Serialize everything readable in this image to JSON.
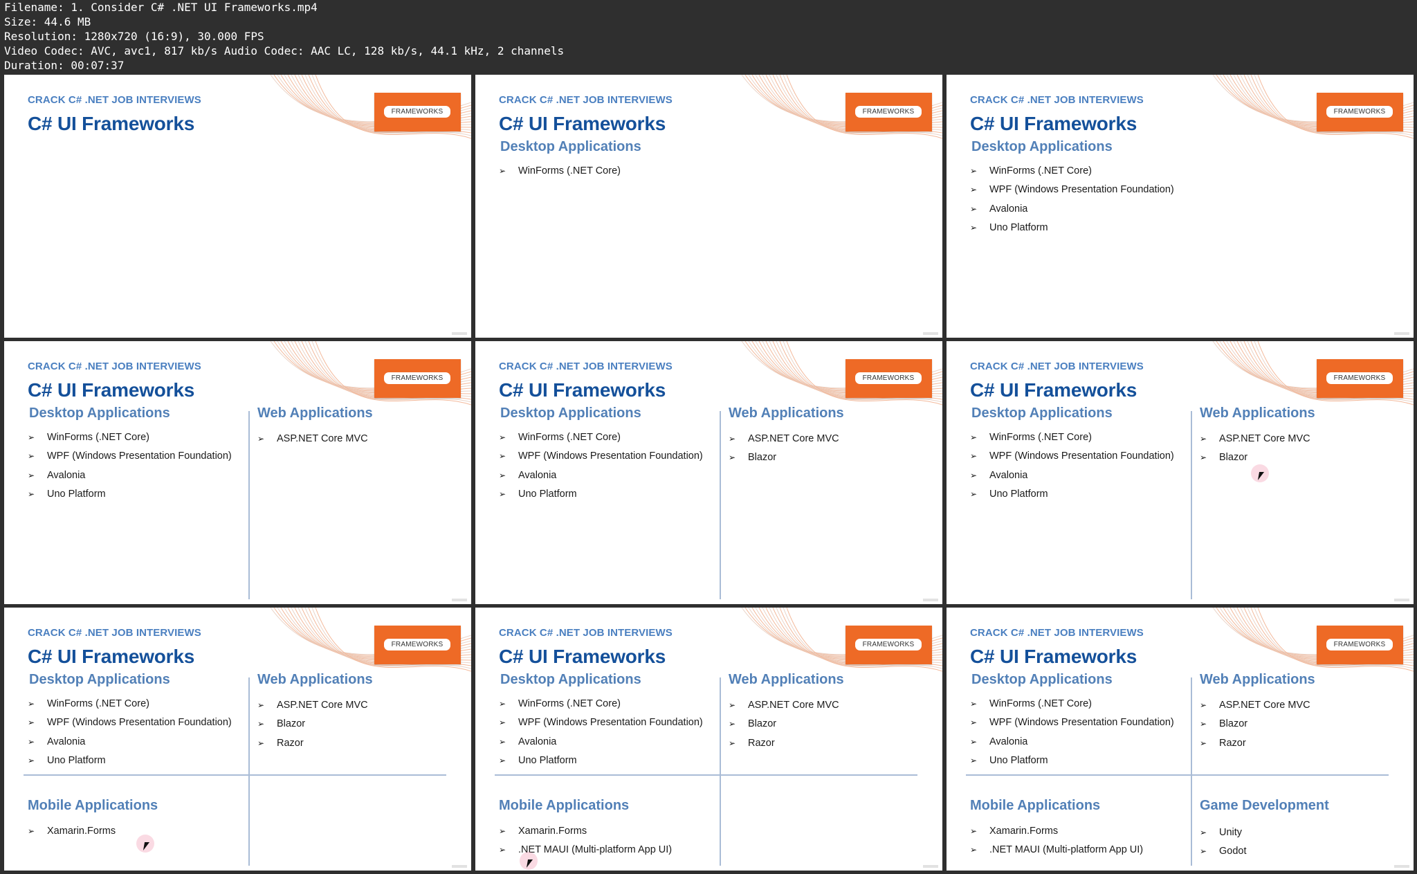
{
  "file_info": {
    "filename": "Filename: 1. Consider C# .NET UI Frameworks.mp4",
    "size": "Size: 44.6 MB",
    "resolution": "Resolution: 1280x720 (16:9), 30.000 FPS",
    "codec": "Video Codec: AVC, avc1, 817 kb/s Audio Codec: AAC LC, 128 kb/s, 44.1 kHz, 2 channels",
    "duration": "Duration: 00:07:37"
  },
  "slide": {
    "kicker": "CRACK C# .NET JOB INTERVIEWS",
    "title": "C# UI Frameworks",
    "badge": "FRAMEWORKS",
    "arrow": "➢"
  },
  "sections": {
    "desktop": "Desktop Applications",
    "web": "Web Applications",
    "mobile": "Mobile Applications",
    "game": "Game Development"
  },
  "items": {
    "desktop": [
      "WinForms (.NET Core)",
      "WPF (Windows Presentation Foundation)",
      "Avalonia",
      "Uno Platform"
    ],
    "web": [
      "ASP.NET Core MVC",
      "Blazor",
      "Razor"
    ],
    "mobile": [
      "Xamarin.Forms",
      ".NET MAUI (Multi-platform App UI)"
    ],
    "game": [
      "Unity",
      "Godot"
    ]
  },
  "thumbnails": [
    {
      "desktop": 0,
      "web": -1,
      "mobile": -1,
      "game": -1,
      "cursor": false
    },
    {
      "desktop": 1,
      "web": -1,
      "mobile": -1,
      "game": -1,
      "cursor": false
    },
    {
      "desktop": 4,
      "web": -1,
      "mobile": -1,
      "game": -1,
      "cursor": false
    },
    {
      "desktop": 4,
      "web": 1,
      "mobile": -1,
      "game": -1,
      "cursor": false
    },
    {
      "desktop": 4,
      "web": 2,
      "mobile": -1,
      "game": -1,
      "cursor": false
    },
    {
      "desktop": 4,
      "web": 2,
      "mobile": -1,
      "game": -1,
      "cursor": true
    },
    {
      "desktop": 4,
      "web": 3,
      "mobile": 1,
      "game": -1,
      "cursor": true
    },
    {
      "desktop": 4,
      "web": 3,
      "mobile": 2,
      "game": -1,
      "cursor": true
    },
    {
      "desktop": 4,
      "web": 3,
      "mobile": 2,
      "game": 2,
      "cursor": false
    }
  ],
  "colors": {
    "kicker": "#4a7fc0",
    "title": "#14509a",
    "section": "#5280b7",
    "badge": "#ee6a26",
    "divider": "#a9bcd6"
  }
}
